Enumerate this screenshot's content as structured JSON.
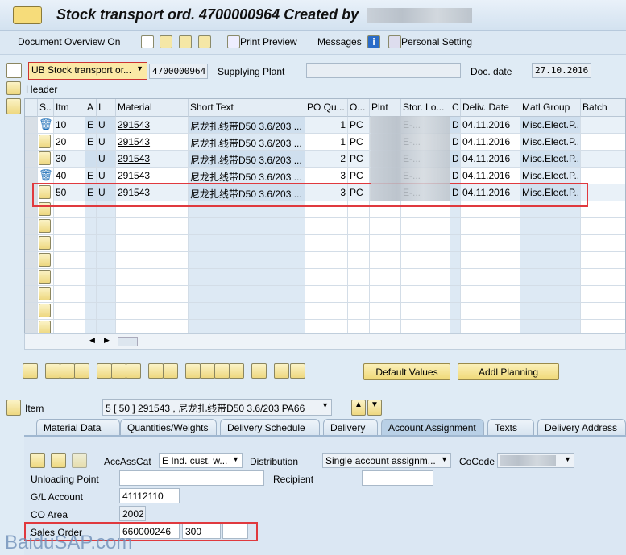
{
  "window": {
    "title": "Stock transport ord. 4700000964 Created by"
  },
  "toolbar": {
    "document_overview": "Document Overview On",
    "print_preview": "Print Preview",
    "messages": "Messages",
    "personal_setting": "Personal Setting"
  },
  "header": {
    "doc_type": "UB Stock transport or...",
    "doc_number": "4700000964",
    "supplying_plant_label": "Supplying Plant",
    "doc_date_label": "Doc. date",
    "doc_date": "27.10.2016",
    "header_label": "Header"
  },
  "table": {
    "columns": [
      "S..",
      "Itm",
      "A",
      "I",
      "Material",
      "Short Text",
      "PO Qu...",
      "O...",
      "Plnt",
      "Stor. Lo...",
      "C",
      "Deliv. Date",
      "Matl Group",
      "Batch"
    ],
    "rows": [
      {
        "status": "trash",
        "itm": "10",
        "a": "E",
        "i": "U",
        "material": "291543",
        "text": "尼龙扎线带D50 3.6/203 ...",
        "qty": "1",
        "unit": "PC",
        "stor": "E-...",
        "c": "D",
        "date": "04.11.2016",
        "group": "Misc.Elect.P..."
      },
      {
        "status": "",
        "itm": "20",
        "a": "E",
        "i": "U",
        "material": "291543",
        "text": "尼龙扎线带D50 3.6/203 ...",
        "qty": "1",
        "unit": "PC",
        "stor": "E-...",
        "c": "D",
        "date": "04.11.2016",
        "group": "Misc.Elect.P..."
      },
      {
        "status": "",
        "itm": "30",
        "a": "",
        "i": "U",
        "material": "291543",
        "text": "尼龙扎线带D50 3.6/203 ...",
        "qty": "2",
        "unit": "PC",
        "stor": "E-...",
        "c": "D",
        "date": "04.11.2016",
        "group": "Misc.Elect.P..."
      },
      {
        "status": "trash",
        "itm": "40",
        "a": "E",
        "i": "U",
        "material": "291543",
        "text": "尼龙扎线带D50 3.6/203 ...",
        "qty": "3",
        "unit": "PC",
        "stor": "E-...",
        "c": "D",
        "date": "04.11.2016",
        "group": "Misc.Elect.P..."
      },
      {
        "status": "",
        "itm": "50",
        "a": "E",
        "i": "U",
        "material": "291543",
        "text": "尼龙扎线带D50 3.6/203 ...",
        "qty": "3",
        "unit": "PC",
        "stor": "E-...",
        "c": "D",
        "date": "04.11.2016",
        "group": "Misc.Elect.P..."
      }
    ]
  },
  "buttons": {
    "default_values": "Default Values",
    "addl_planning": "Addl Planning"
  },
  "item": {
    "label": "Item",
    "selected": "5 [ 50 ] 291543 , 尼龙扎线带D50 3.6/203 PA66"
  },
  "tabs": [
    "Material Data",
    "Quantities/Weights",
    "Delivery Schedule",
    "Delivery",
    "Account Assignment",
    "Texts",
    "Delivery Address"
  ],
  "account": {
    "acc_ass_cat_label": "AccAssCat",
    "acc_ass_cat": "E Ind. cust. w...",
    "distribution_label": "Distribution",
    "distribution": "Single account assignm...",
    "cocode_label": "CoCode",
    "unloading_label": "Unloading Point",
    "unloading": "",
    "recipient_label": "Recipient",
    "recipient": "",
    "gl_label": "G/L Account",
    "gl": "41112110",
    "co_area_label": "CO Area",
    "co_area": "2002",
    "sales_order_label": "Sales Order",
    "sales_order": "660000246",
    "sales_item": "300",
    "sales_extra": ""
  },
  "watermark": "BaiduSAP.com",
  "colors": {
    "highlight": "#e0393e",
    "button": "#f0d978"
  }
}
